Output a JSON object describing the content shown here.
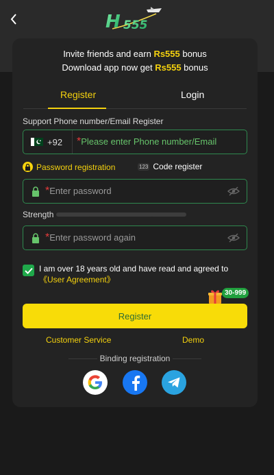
{
  "header": {
    "logo_text": "H555"
  },
  "promo": {
    "line1_prefix": "Invite friends and earn ",
    "line1_highlight": "Rs555",
    "line1_suffix": " bonus",
    "line2_prefix": "Download app now get ",
    "line2_highlight": "Rs555",
    "line2_suffix": " bonus"
  },
  "tabs": {
    "register": "Register",
    "login": "Login",
    "active": "register"
  },
  "phone": {
    "label": "Support Phone number/Email Register",
    "country_code": "+92",
    "required_mark": "*",
    "placeholder": "Please enter Phone number/Email"
  },
  "modes": {
    "password_registration": "Password registration",
    "code_badge": "123",
    "code_register": "Code register"
  },
  "password": {
    "required_mark": "*",
    "placeholder": "Enter password"
  },
  "strength": {
    "label": "Strength",
    "level": 0,
    "segments": 4
  },
  "confirm_password": {
    "required_mark": "*",
    "placeholder": "Enter password again"
  },
  "agreement": {
    "checked": true,
    "text": "I am over 18 years old and have read and agreed to ",
    "link": "《User Agreement》"
  },
  "register_button": {
    "label": "Register",
    "badge": "30-999"
  },
  "links": {
    "customer_service": "Customer Service",
    "demo": "Demo"
  },
  "binding": {
    "label": "Binding registration",
    "providers": [
      "google",
      "facebook",
      "telegram"
    ]
  },
  "colors": {
    "accent_yellow": "#f5d20e",
    "field_border": "#2f8a4f",
    "check_green": "#1fa84a",
    "required_red": "#e63b3b",
    "facebook_blue": "#1877f2",
    "telegram_blue": "#2aa3e0"
  }
}
